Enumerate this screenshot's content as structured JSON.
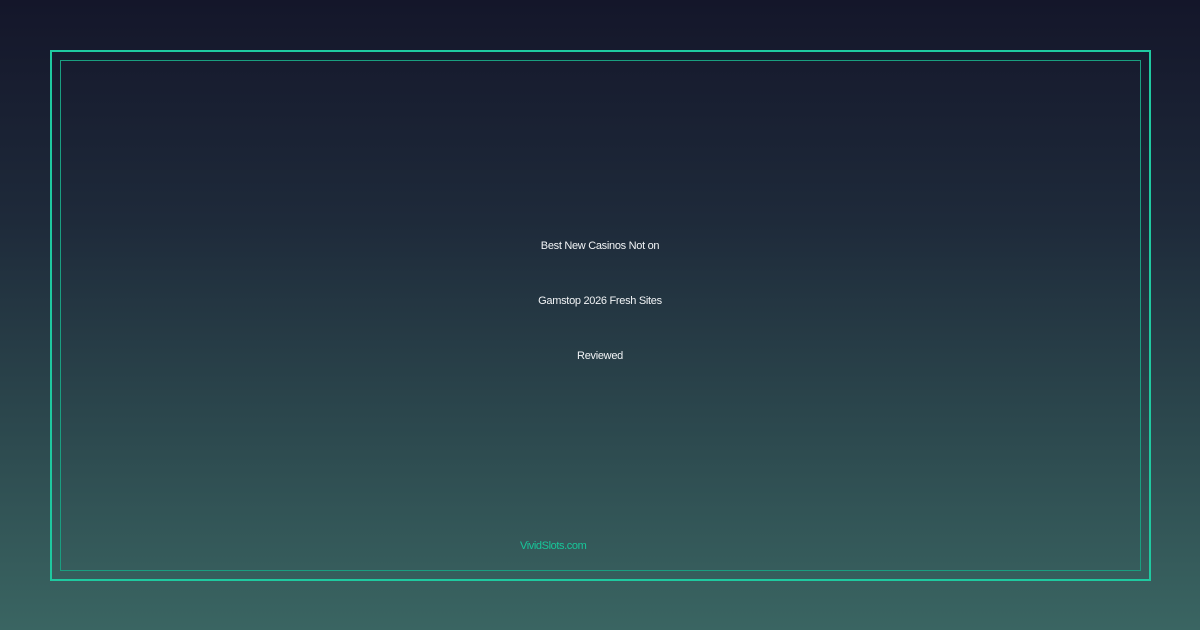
{
  "card": {
    "title_lines": [
      "Best New Casinos Not on",
      "Gamstop 2026 Fresh Sites",
      "Reviewed"
    ],
    "site_name": "VividSlots.com"
  },
  "colors": {
    "accent": "#1fc9a0",
    "text": "#f2f4f6",
    "background_top": "#14162a",
    "background_bottom": "#3a6562"
  }
}
